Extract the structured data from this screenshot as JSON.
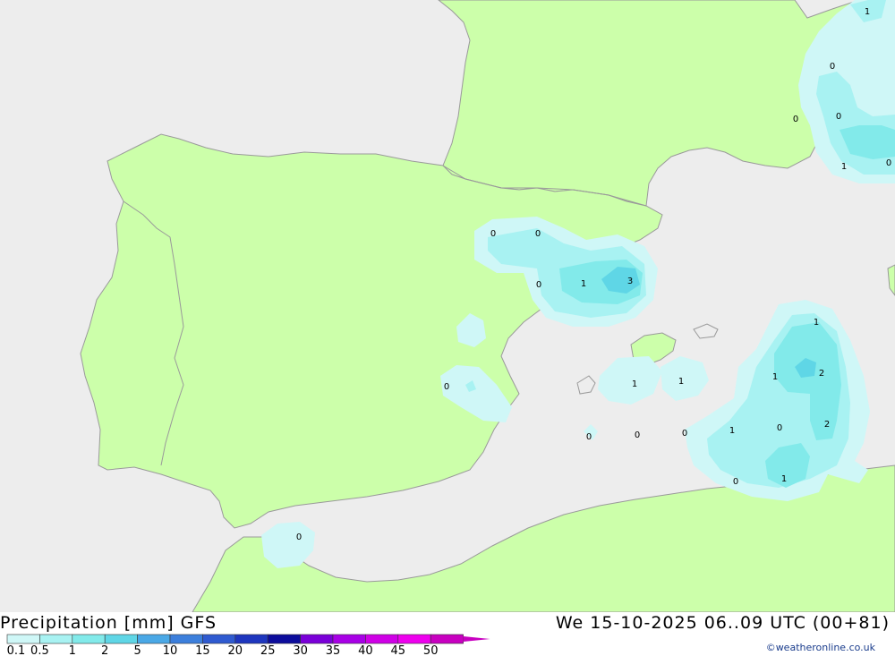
{
  "map": {
    "colors": {
      "sea": "#ededed",
      "land": "#ccffaa",
      "border": "#9a9a9a"
    },
    "contour_labels": [
      {
        "text": "1",
        "lon": 969,
        "lat": 12
      },
      {
        "text": "0",
        "lon": 930,
        "lat": 73
      },
      {
        "text": "0",
        "lon": 889,
        "lat": 132
      },
      {
        "text": "0",
        "lon": 937,
        "lat": 129
      },
      {
        "text": "1",
        "lon": 943,
        "lat": 185
      },
      {
        "text": "0",
        "lon": 993,
        "lat": 181
      },
      {
        "text": "0",
        "lon": 551,
        "lat": 260
      },
      {
        "text": "0",
        "lon": 601,
        "lat": 260
      },
      {
        "text": "0",
        "lon": 602,
        "lat": 317
      },
      {
        "text": "1",
        "lon": 652,
        "lat": 316
      },
      {
        "text": "3",
        "lon": 704,
        "lat": 313
      },
      {
        "text": "0",
        "lon": 499,
        "lat": 431
      },
      {
        "text": "1",
        "lon": 912,
        "lat": 359
      },
      {
        "text": "1",
        "lon": 866,
        "lat": 420
      },
      {
        "text": "2",
        "lon": 918,
        "lat": 416
      },
      {
        "text": "2",
        "lon": 924,
        "lat": 473
      },
      {
        "text": "1",
        "lon": 709,
        "lat": 428
      },
      {
        "text": "1",
        "lon": 761,
        "lat": 425
      },
      {
        "text": "0",
        "lon": 658,
        "lat": 487
      },
      {
        "text": "0",
        "lon": 712,
        "lat": 485
      },
      {
        "text": "0",
        "lon": 765,
        "lat": 483
      },
      {
        "text": "1",
        "lon": 818,
        "lat": 480
      },
      {
        "text": "0",
        "lon": 871,
        "lat": 477
      },
      {
        "text": "1",
        "lon": 876,
        "lat": 534
      },
      {
        "text": "0",
        "lon": 822,
        "lat": 537
      },
      {
        "text": "0",
        "lon": 334,
        "lat": 599
      }
    ]
  },
  "footer": {
    "title": "Precipitation [mm] GFS",
    "timestamp": "We 15-10-2025 06..09 UTC (00+81)",
    "credit": "©weatheronline.co.uk"
  },
  "legend": {
    "ticks": [
      "0.1",
      "0.5",
      "1",
      "2",
      "5",
      "10",
      "15",
      "20",
      "25",
      "30",
      "35",
      "40",
      "45",
      "50"
    ],
    "colors": [
      "#cff7f7",
      "#a8f2f2",
      "#82eaea",
      "#5fd6e6",
      "#4aa8e6",
      "#3c7fdc",
      "#2f5ad0",
      "#1e36be",
      "#0c0c9c",
      "#7a00d8",
      "#a800e6",
      "#cf00e6",
      "#ee00ee",
      "#c800c0"
    ]
  }
}
